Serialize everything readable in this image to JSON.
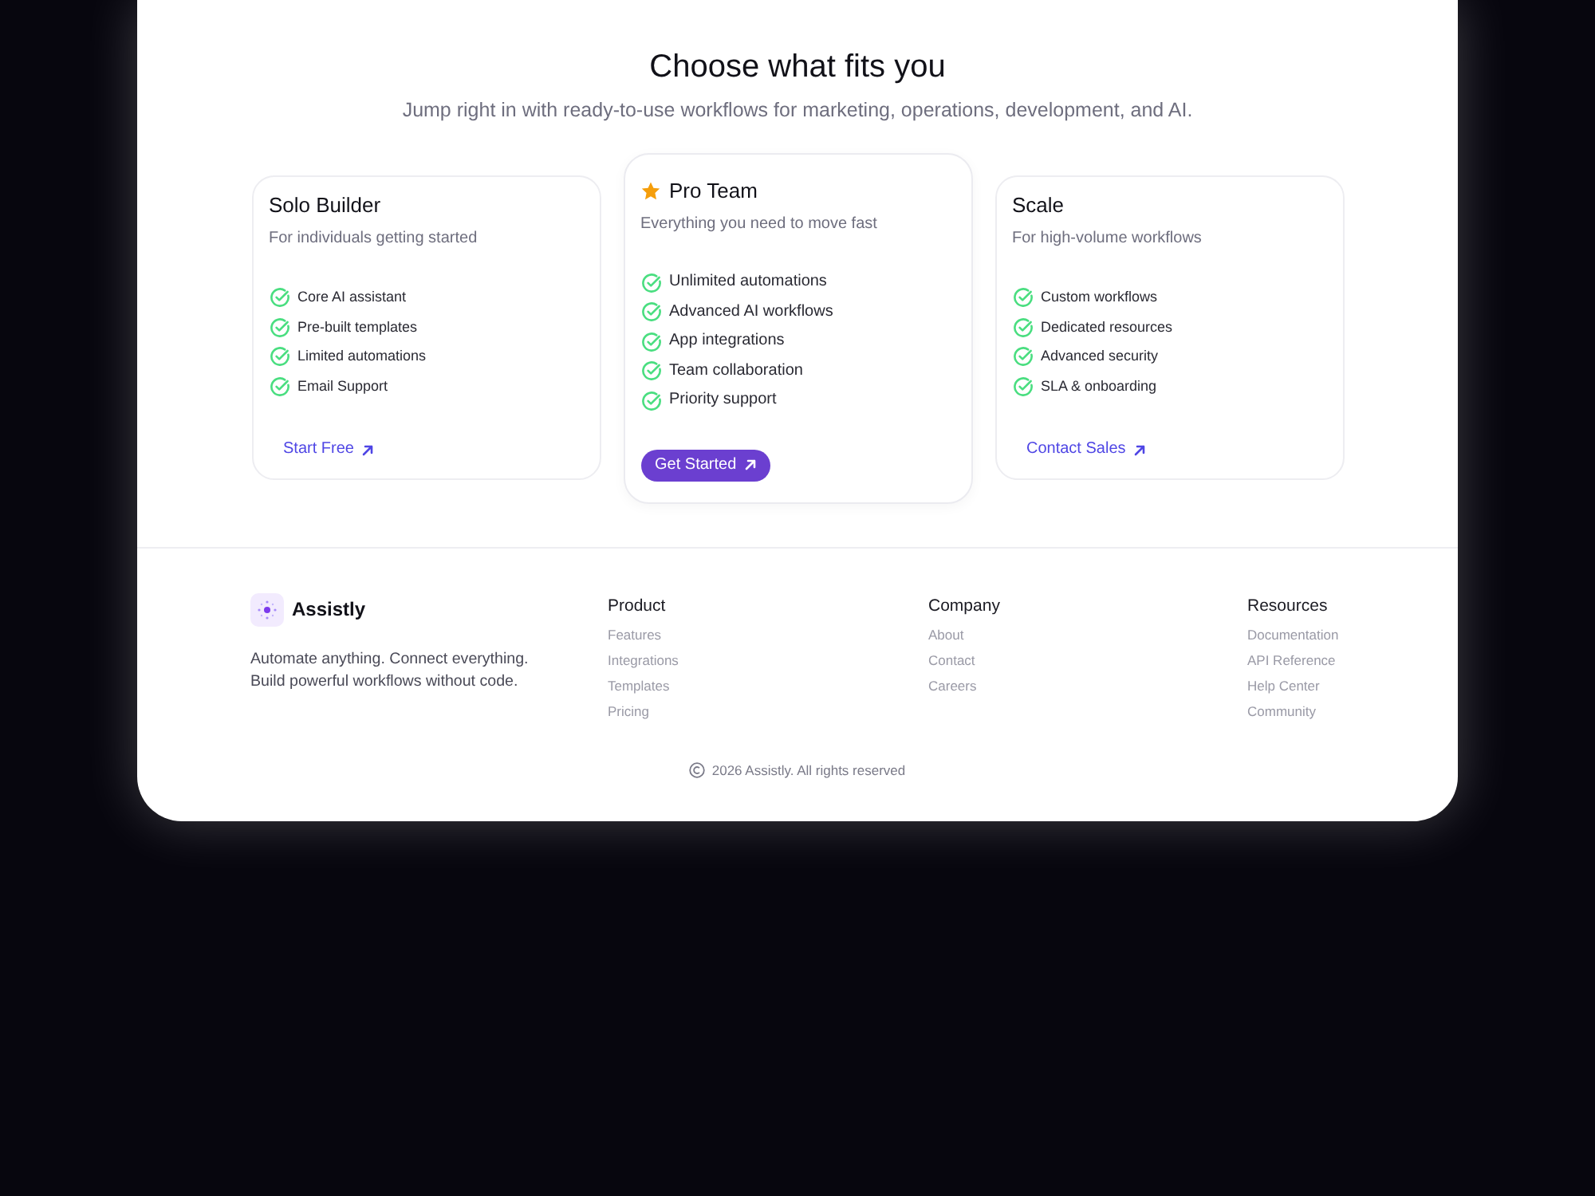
{
  "heading": "Choose what fits you",
  "subheading": "Jump right in with ready-to-use workflows for marketing, operations, development, and AI.",
  "plans": [
    {
      "name": "Solo Builder",
      "featured": false,
      "description": "For individuals getting started",
      "features": [
        "Core AI assistant",
        "Pre-built templates",
        "Limited automations",
        "Email Support"
      ],
      "cta": {
        "label": "Start Free",
        "kind": "link"
      }
    },
    {
      "name": "Pro Team",
      "featured": true,
      "description": "Everything you need to move fast",
      "features": [
        "Unlimited automations",
        "Advanced AI workflows",
        "App integrations",
        "Team collaboration",
        "Priority support"
      ],
      "cta": {
        "label": "Get Started",
        "kind": "button"
      }
    },
    {
      "name": "Scale",
      "featured": false,
      "description": "For high-volume workflows",
      "features": [
        "Custom workflows",
        "Dedicated resources",
        "Advanced security",
        "SLA & onboarding"
      ],
      "cta": {
        "label": "Contact Sales",
        "kind": "link"
      }
    }
  ],
  "footer": {
    "brand": {
      "name": "Assistly",
      "tagline": "Automate anything. Connect everything. Build powerful workflows without code."
    },
    "columns": [
      {
        "title": "Product",
        "links": [
          "Features",
          "Integrations",
          "Templates",
          "Pricing"
        ]
      },
      {
        "title": "Company",
        "links": [
          "About",
          "Contact",
          "Careers"
        ]
      },
      {
        "title": "Resources",
        "links": [
          "Documentation",
          "API Reference",
          "Help Center",
          "Community"
        ]
      }
    ],
    "copyright": "2026 Assistly. All rights reserved"
  }
}
